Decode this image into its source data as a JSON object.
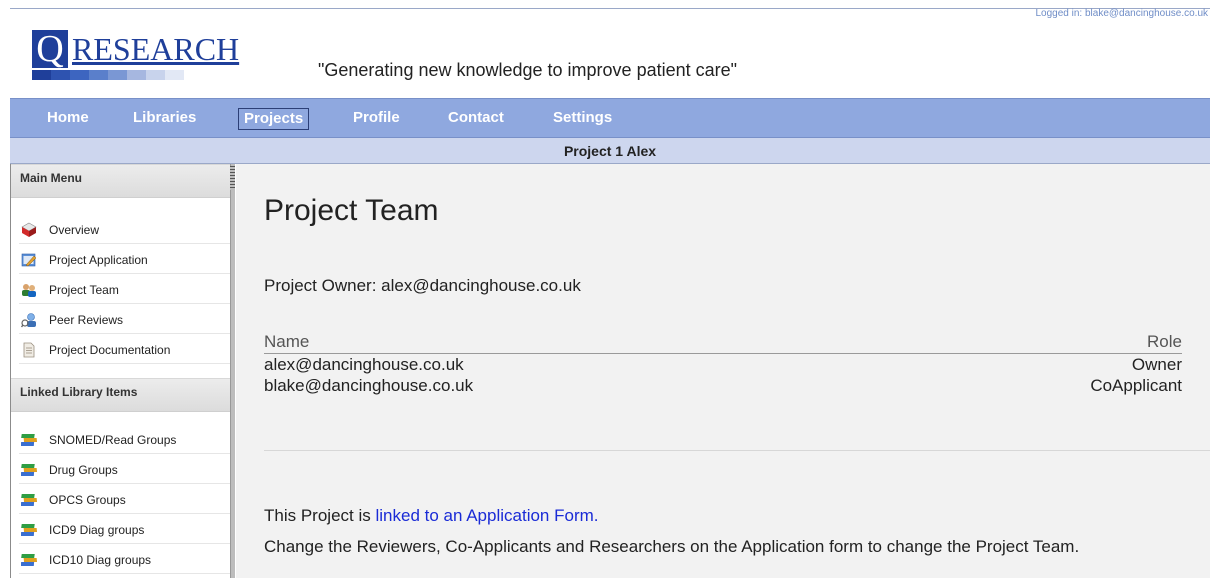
{
  "header": {
    "logged_in": "Logged in: blake@dancinghouse.co.uk",
    "logo_letter": "Q",
    "logo_word": "RESEARCH",
    "tagline": "\"Generating new knowledge to improve patient care\"",
    "logo_bar_colors": [
      "#1f3f9a",
      "#2e53b0",
      "#3d65c0",
      "#5a7fcb",
      "#7a97d4",
      "#a6b7e0",
      "#c8d3ec",
      "#e2e8f5"
    ]
  },
  "nav": {
    "items": [
      "Home",
      "Libraries",
      "Projects",
      "Profile",
      "Contact",
      "Settings"
    ],
    "active": "Projects"
  },
  "project_bar": {
    "title": "Project 1 Alex"
  },
  "sidebar": {
    "main_menu_title": "Main Menu",
    "main_menu": [
      {
        "label": "Overview",
        "icon": "cube-icon"
      },
      {
        "label": "Project Application",
        "icon": "edit-form-icon"
      },
      {
        "label": "Project Team",
        "icon": "team-icon"
      },
      {
        "label": "Peer Reviews",
        "icon": "reviewer-icon"
      },
      {
        "label": "Project Documentation",
        "icon": "document-icon"
      }
    ],
    "linked_title": "Linked Library Items",
    "linked_items": [
      {
        "label": "SNOMED/Read Groups",
        "icon": "books-icon"
      },
      {
        "label": "Drug Groups",
        "icon": "books-icon"
      },
      {
        "label": "OPCS Groups",
        "icon": "books-icon"
      },
      {
        "label": "ICD9 Diag groups",
        "icon": "books-icon"
      },
      {
        "label": "ICD10 Diag groups",
        "icon": "books-icon"
      }
    ]
  },
  "main": {
    "title": "Project Team",
    "owner_text": "Project Owner: alex@dancinghouse.co.uk",
    "columns": {
      "name": "Name",
      "role": "Role"
    },
    "rows": [
      {
        "name": "alex@dancinghouse.co.uk",
        "role": "Owner"
      },
      {
        "name": "blake@dancinghouse.co.uk",
        "role": "CoApplicant"
      }
    ],
    "linked_prefix": "This Project is ",
    "linked_link": "linked to an Application Form.",
    "change_text": "Change the Reviewers, Co-Applicants and Researchers on the Application form to change the Project Team."
  }
}
